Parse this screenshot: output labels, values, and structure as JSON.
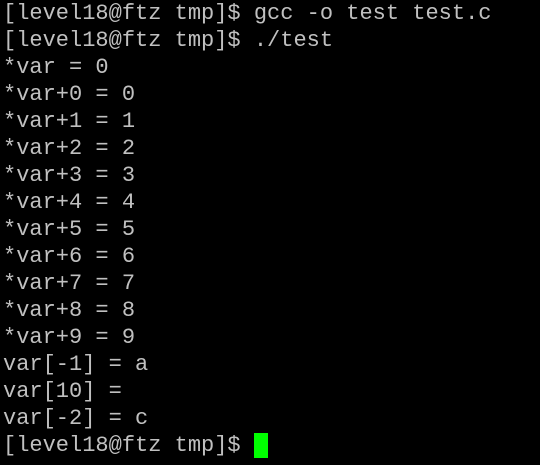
{
  "colors": {
    "background": "#000000",
    "text": "#c0c0c0",
    "cursor": "#00ff00"
  },
  "terminal": {
    "lines": [
      "[level18@ftz tmp]$ gcc -o test test.c",
      "[level18@ftz tmp]$ ./test",
      "*var = 0",
      "*var+0 = 0",
      "*var+1 = 1",
      "*var+2 = 2",
      "*var+3 = 3",
      "*var+4 = 4",
      "*var+5 = 5",
      "*var+6 = 6",
      "*var+7 = 7",
      "*var+8 = 8",
      "*var+9 = 9",
      "var[-1] = a",
      "var[10] =",
      "var[-2] = c"
    ],
    "prompt": "[level18@ftz tmp]$ "
  }
}
